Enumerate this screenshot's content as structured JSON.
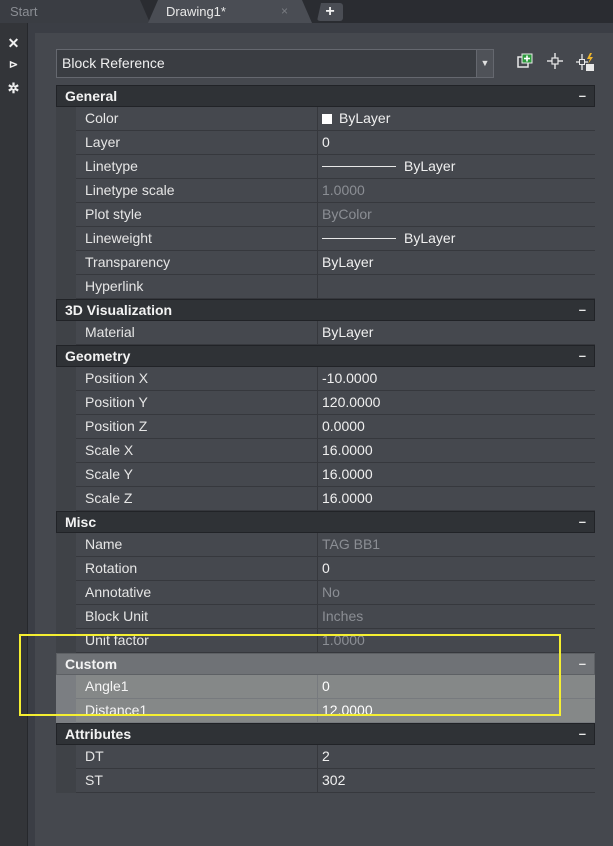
{
  "tabs": {
    "start_label": "Start",
    "drawing_label": "Drawing1*",
    "close_glyph": "×",
    "add_glyph": "+"
  },
  "side": {
    "close_glyph": "✕",
    "pin_glyph": "⊳",
    "settings_glyph": "✲"
  },
  "selection": {
    "value": "Block Reference"
  },
  "toolbar": {
    "icons": [
      "quick-select-icon",
      "pick-objects-icon",
      "toggle-pickadd-icon"
    ]
  },
  "sections": {
    "general": {
      "title": "General",
      "toggle": "–",
      "rows": [
        {
          "name": "Color",
          "value": "ByLayer"
        },
        {
          "name": "Layer",
          "value": "0"
        },
        {
          "name": "Linetype",
          "value": "ByLayer"
        },
        {
          "name": "Linetype scale",
          "value": "1.0000"
        },
        {
          "name": "Plot style",
          "value": "ByColor"
        },
        {
          "name": "Lineweight",
          "value": "ByLayer"
        },
        {
          "name": "Transparency",
          "value": "ByLayer"
        },
        {
          "name": "Hyperlink",
          "value": ""
        }
      ]
    },
    "vis3d": {
      "title": "3D Visualization",
      "toggle": "–",
      "rows": [
        {
          "name": "Material",
          "value": "ByLayer"
        }
      ]
    },
    "geometry": {
      "title": "Geometry",
      "toggle": "–",
      "rows": [
        {
          "name": "Position X",
          "value": "-10.0000"
        },
        {
          "name": "Position Y",
          "value": "120.0000"
        },
        {
          "name": "Position Z",
          "value": "0.0000"
        },
        {
          "name": "Scale X",
          "value": "16.0000"
        },
        {
          "name": "Scale Y",
          "value": "16.0000"
        },
        {
          "name": "Scale Z",
          "value": "16.0000"
        }
      ]
    },
    "misc": {
      "title": "Misc",
      "toggle": "–",
      "rows": [
        {
          "name": "Name",
          "value": "TAG BB1"
        },
        {
          "name": "Rotation",
          "value": "0"
        },
        {
          "name": "Annotative",
          "value": "No"
        },
        {
          "name": "Block Unit",
          "value": "Inches"
        },
        {
          "name": "Unit factor",
          "value": "1.0000"
        }
      ]
    },
    "custom": {
      "title": "Custom",
      "toggle": "–",
      "rows": [
        {
          "name": "Angle1",
          "value": "0"
        },
        {
          "name": "Distance1",
          "value": "12.0000"
        }
      ]
    },
    "attributes": {
      "title": "Attributes",
      "toggle": "–",
      "rows": [
        {
          "name": "DT",
          "value": "2"
        },
        {
          "name": "ST",
          "value": "302"
        }
      ]
    }
  },
  "colors": {
    "highlight": "#f5ef31",
    "panel": "#45484e",
    "header": "#2f3236"
  }
}
